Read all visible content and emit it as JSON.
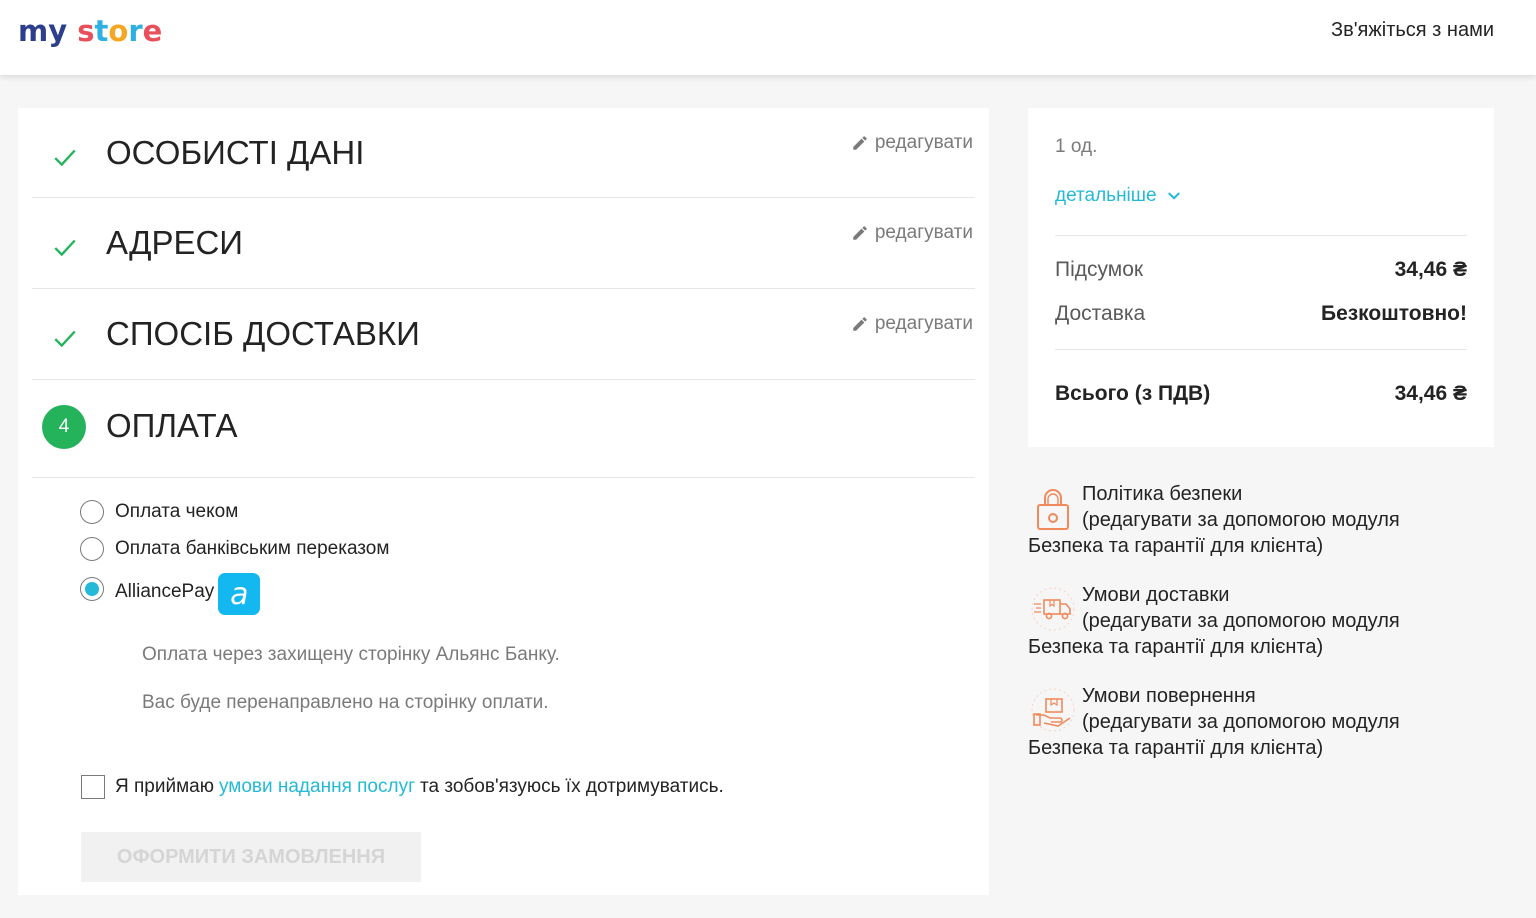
{
  "header": {
    "logo_my": "my",
    "logo_store": [
      "s",
      "t",
      "o",
      "r",
      "e"
    ],
    "contact": "Зв'яжіться з нами"
  },
  "steps": [
    {
      "title": "ОСОБИСТІ ДАНІ",
      "edit": "редагувати",
      "state": "complete"
    },
    {
      "title": "АДРЕСИ",
      "edit": "редагувати",
      "state": "complete"
    },
    {
      "title": "СПОСІБ ДОСТАВКИ",
      "edit": "редагувати",
      "state": "complete"
    },
    {
      "title": "ОПЛАТА",
      "number": "4",
      "state": "current"
    }
  ],
  "payment": {
    "options": [
      {
        "label": "Оплата чеком",
        "selected": false
      },
      {
        "label": "Оплата банківським переказом",
        "selected": false
      },
      {
        "label": "AlliancePay",
        "selected": true,
        "logo_letter": "a"
      }
    ],
    "info": [
      "Оплата через захищену сторінку Альянс Банку.",
      "Вас буде перенаправлено на сторінку оплати."
    ],
    "terms_prefix": "Я приймаю",
    "terms_link": "умови надання послуг",
    "terms_suffix": "та зобов'язуюсь їх дотримуватись.",
    "order_button": "ОФОРМИТИ ЗАМОВЛЕННЯ"
  },
  "summary": {
    "quantity": "1 од.",
    "details_link": "детальніше",
    "subtotal_label": "Підсумок",
    "subtotal_value": "34,46 ₴",
    "shipping_label": "Доставка",
    "shipping_value": "Безкоштовно!",
    "total_label": "Всього (з ПДВ)",
    "total_value": "34,46 ₴"
  },
  "reassurance": [
    {
      "title": "Політика безпеки",
      "line2": "(редагувати за допомогою модуля",
      "line3": "Безпека та гарантії для клієнта)",
      "icon": "lock-icon"
    },
    {
      "title": "Умови доставки",
      "line2": "(редагувати за допомогою модуля",
      "line3": "Безпека та гарантії для клієнта)",
      "icon": "delivery-truck-icon"
    },
    {
      "title": "Умови повернення",
      "line2": "(редагувати за допомогою модуля",
      "line3": "Безпека та гарантії для клієнта)",
      "icon": "return-box-icon"
    }
  ],
  "colors": {
    "accent": "#24b9d7",
    "success": "#24b35a",
    "alliance_blue": "#14b8f0",
    "reassurance_icon": "#f08a5d"
  }
}
